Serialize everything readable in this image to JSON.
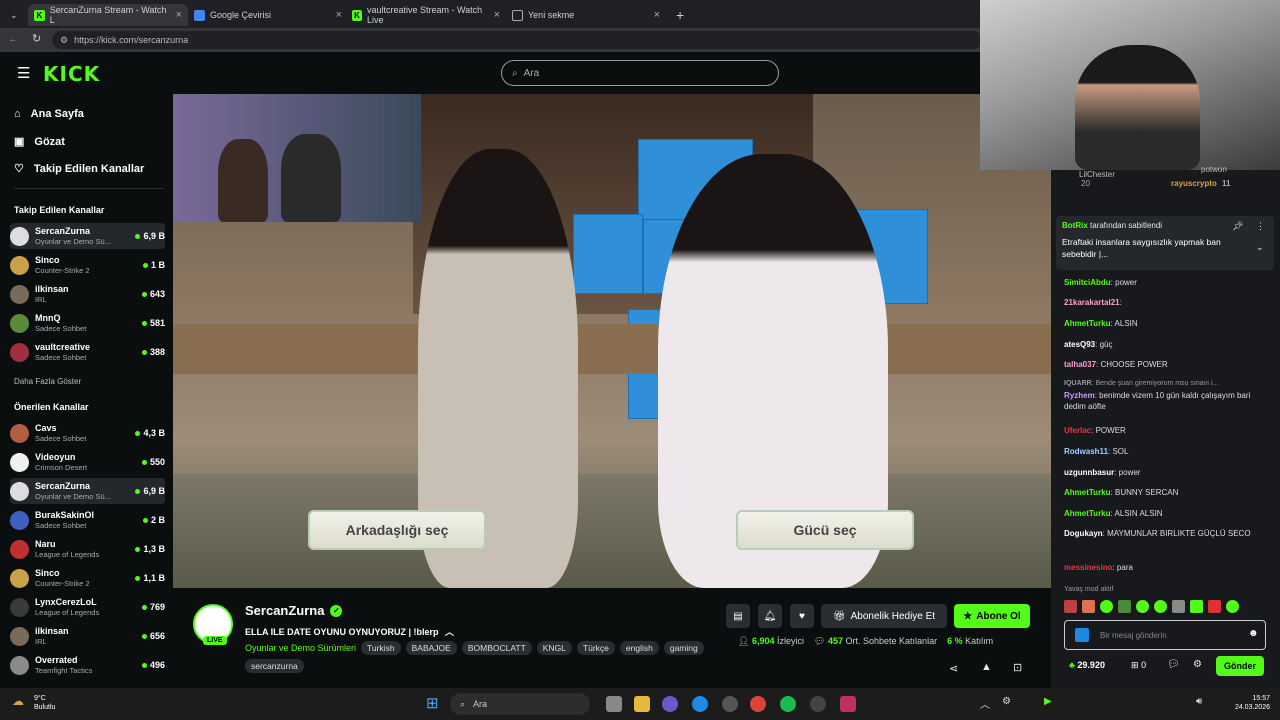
{
  "tabs": [
    {
      "label": "SercanZurna Stream - Watch L"
    },
    {
      "label": "Google Çevirisi"
    },
    {
      "label": "vaultcreative Stream - Watch Live"
    },
    {
      "label": "Yeni sekme"
    }
  ],
  "browser": {
    "url": "https://kick.com/sercanzurna"
  },
  "header": {
    "logo": "KICK",
    "search_placeholder": "Ara"
  },
  "sidebar": {
    "nav": [
      {
        "label": "Ana Sayfa"
      },
      {
        "label": "Gözat"
      },
      {
        "label": "Takip Edilen Kanallar"
      }
    ],
    "followed_title": "Takip Edilen Kanallar",
    "followed": [
      {
        "name": "SercanZurna",
        "sub": "Oyunlar ve Demo Sü...",
        "viewers": "6,9 B"
      },
      {
        "name": "Sinco",
        "sub": "Counter-Strike 2",
        "viewers": "1 B"
      },
      {
        "name": "ilkinsan",
        "sub": "IRL",
        "viewers": "643"
      },
      {
        "name": "MnnQ",
        "sub": "Sadece Sohbet",
        "viewers": "581"
      },
      {
        "name": "vaultcreative",
        "sub": "Sadece Sohbet",
        "viewers": "388"
      }
    ],
    "show_more": "Daha Fazla Göster",
    "recommended_title": "Önerilen Kanallar",
    "recommended": [
      {
        "name": "Cavs",
        "sub": "Sadece Sohbet",
        "viewers": "4,3 B"
      },
      {
        "name": "Videoyun",
        "sub": "Crimson Desert",
        "viewers": "550"
      },
      {
        "name": "SercanZurna",
        "sub": "Oyunlar ve Demo Sü...",
        "viewers": "6,9 B"
      },
      {
        "name": "BurakSakinOl",
        "sub": "Sadece Sohbet",
        "viewers": "2 B"
      },
      {
        "name": "Naru",
        "sub": "League of Legends",
        "viewers": "1,3 B"
      },
      {
        "name": "Sinco",
        "sub": "Counter-Strike 2",
        "viewers": "1,1 B"
      },
      {
        "name": "LynxCerezLoL",
        "sub": "League of Legends",
        "viewers": "769"
      },
      {
        "name": "ilkinsan",
        "sub": "IRL",
        "viewers": "656"
      },
      {
        "name": "Overrated",
        "sub": "Teamfight Tactics",
        "viewers": "496"
      }
    ]
  },
  "video": {
    "choice_left": "Arkadaşlığı seç",
    "choice_right": "Gücü seç"
  },
  "stream": {
    "live_badge": "LIVE",
    "name": "SercanZurna",
    "title": "ELLA ILE DATE OYUNU OYNUYORUZ | !blerp",
    "category": "Oyunlar ve Demo Sürümleri",
    "tags": [
      "Turkish",
      "BABAJOE",
      "BOMBOCLATT",
      "KNGL",
      "Türkçe",
      "english",
      "gaming",
      "sercanzurna"
    ],
    "gift_label": "Abonelik Hediye Et",
    "subscribe_label": "Abone Ol",
    "viewers": "6,904",
    "viewers_label": "İzleyici",
    "chatters": "457",
    "chatters_label": "Ort. Sohbete Katılanlar",
    "participation": "6 %",
    "participation_label": "Katılım"
  },
  "chat": {
    "top": [
      {
        "user": "LilChester",
        "points": "20"
      },
      {
        "user": "rayuscrypto",
        "points": "11"
      }
    ],
    "top_partial": "potwon",
    "pinned_by": "BotRix",
    "pinned_suffix": "tarafından sabitlendi",
    "pinned_text": "Etraftaki insanlara saygısızlık yapmak ban sebebidir",
    "pinned_ellipsis": "|...",
    "messages": [
      {
        "user": "SimitciAbdu",
        "text": "power",
        "color": "#53fc18"
      },
      {
        "user": "21karakartal21",
        "text": "",
        "color": "#ff9fd0"
      },
      {
        "user": "AhmetTurku",
        "text": "ALSIN",
        "color": "#53fc18"
      },
      {
        "user": "atesQ93",
        "text": "güç",
        "color": "#ffffff"
      },
      {
        "user": "talha037",
        "text": "CHOOSE POWER",
        "color": "#ff9fd0"
      },
      {
        "user": "IQUARR",
        "text": "Bende şuan giremiyorum msu sınavı i...",
        "color": "#9a9a9a"
      },
      {
        "user": "Ryzhem",
        "text": "benimde vizem 10 gün kaldı çalışayım bari dedim aöfte",
        "color": "#c89bff"
      },
      {
        "user": "Uferlac",
        "text": "POWER",
        "color": "#e34"
      },
      {
        "user": "Rodwash11",
        "text": "SOL",
        "color": "#9fd0ff"
      },
      {
        "user": "uzgunnbasur",
        "text": "power",
        "color": "#ffffff"
      },
      {
        "user": "AhmetTurku",
        "text": "BUNNY SERCAN",
        "color": "#53fc18"
      },
      {
        "user": "AhmetTurku",
        "text": "ALSIN ALSIN",
        "color": "#53fc18"
      },
      {
        "user": "Dogukayn",
        "text": "MAYMUNLAR BIRLIKTE GÜÇLÜ SECO",
        "color": "#ffffff"
      },
      {
        "user": "messinesino",
        "text": "para",
        "color": "#e34"
      }
    ],
    "slow_mode": "Yavaş mod aktif",
    "input_placeholder": "Bir mesaj gönderin",
    "points": "29.920",
    "gifts": "0",
    "send_label": "Gönder"
  },
  "taskbar": {
    "weather_temp": "9°C",
    "weather_text": "Bulutlu",
    "search": "Ara",
    "time": "15:57",
    "date": "24.03.2026"
  }
}
